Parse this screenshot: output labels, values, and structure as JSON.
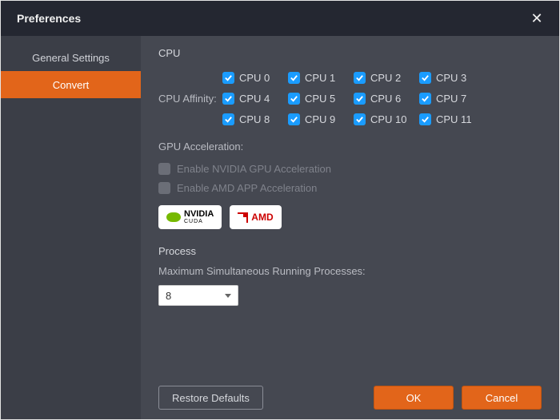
{
  "window": {
    "title": "Preferences"
  },
  "sidebar": {
    "items": [
      {
        "label": "General Settings",
        "selected": false
      },
      {
        "label": "Convert",
        "selected": true
      }
    ]
  },
  "cpu": {
    "section_title": "CPU",
    "affinity_label": "CPU Affinity:",
    "items": [
      {
        "label": "CPU 0",
        "checked": true
      },
      {
        "label": "CPU 1",
        "checked": true
      },
      {
        "label": "CPU 2",
        "checked": true
      },
      {
        "label": "CPU 3",
        "checked": true
      },
      {
        "label": "CPU 4",
        "checked": true
      },
      {
        "label": "CPU 5",
        "checked": true
      },
      {
        "label": "CPU 6",
        "checked": true
      },
      {
        "label": "CPU 7",
        "checked": true
      },
      {
        "label": "CPU 8",
        "checked": true
      },
      {
        "label": "CPU 9",
        "checked": true
      },
      {
        "label": "CPU 10",
        "checked": true
      },
      {
        "label": "CPU 11",
        "checked": true
      }
    ]
  },
  "gpu": {
    "title": "GPU Acceleration:",
    "nvidia_label": "Enable NVIDIA GPU Acceleration",
    "amd_label": "Enable AMD APP Acceleration",
    "nvidia_badge_main": "NVIDIA",
    "nvidia_badge_sub": "CUDA",
    "amd_badge": "AMD"
  },
  "process": {
    "section_title": "Process",
    "label": "Maximum Simultaneous Running Processes:",
    "value": "8"
  },
  "buttons": {
    "restore": "Restore Defaults",
    "ok": "OK",
    "cancel": "Cancel"
  }
}
